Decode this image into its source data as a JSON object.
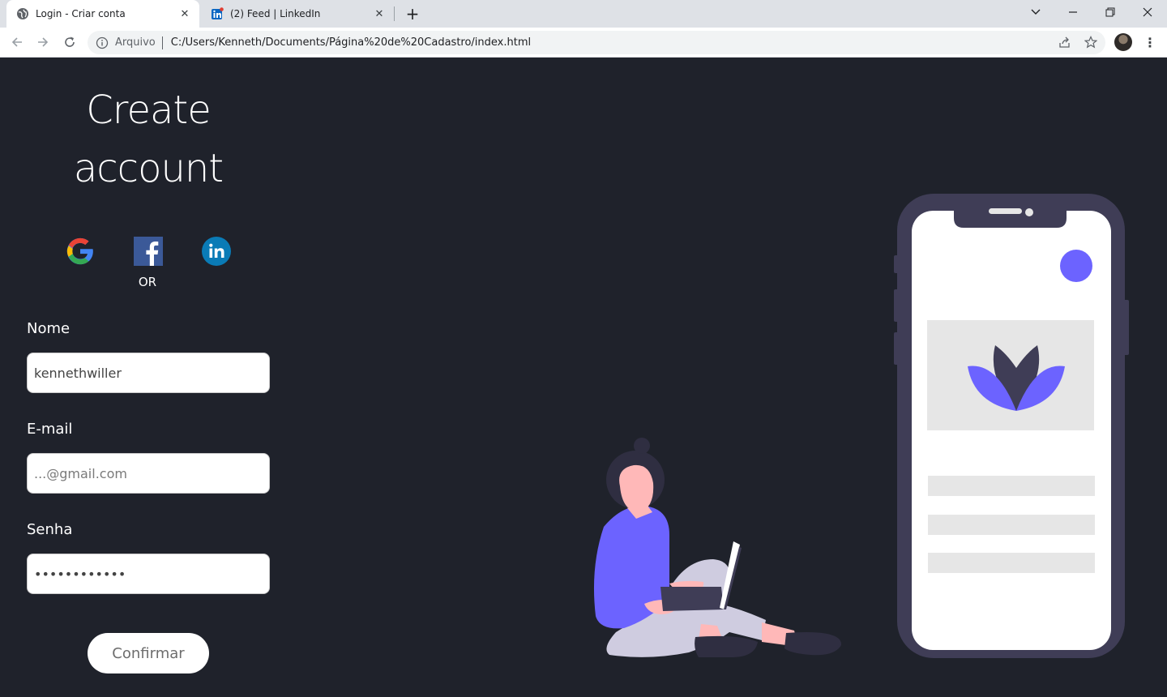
{
  "browser": {
    "tabs": [
      {
        "title": "Login - Criar conta",
        "active": true,
        "icon": "globe-icon"
      },
      {
        "title": "(2) Feed | LinkedIn",
        "active": false,
        "icon": "linkedin-icon"
      }
    ],
    "address": {
      "scheme_label": "Arquivo",
      "url": "C:/Users/Kenneth/Documents/Página%20de%20Cadastro/index.html"
    }
  },
  "page": {
    "heading_line1": "Create",
    "heading_line2": "account",
    "social": [
      "google-icon",
      "facebook-icon",
      "linkedin-icon"
    ],
    "or_text": "OR",
    "fields": {
      "name": {
        "label": "Nome",
        "value": "kennethwiller",
        "placeholder": ""
      },
      "email": {
        "label": "E-mail",
        "value": "",
        "placeholder": "...@gmail.com"
      },
      "password": {
        "label": "Senha",
        "value": "••••••••••••",
        "placeholder": ""
      }
    },
    "confirm_label": "Confirmar"
  },
  "colors": {
    "background": "#1f222b",
    "accent": "#6c63ff",
    "phone_frame": "#3f3d56",
    "skin": "#ffb8b8"
  }
}
